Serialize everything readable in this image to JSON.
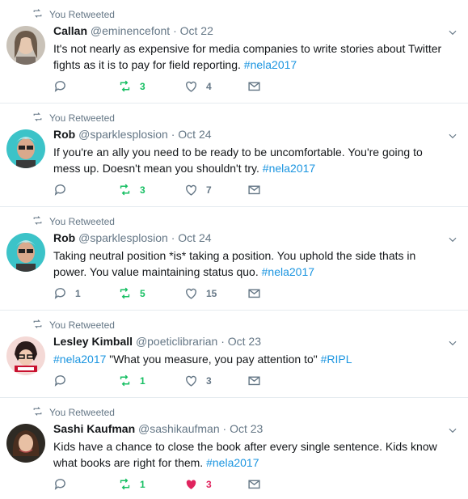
{
  "retweet_context": "You Retweeted",
  "tweets": [
    {
      "name": "Callan",
      "handle": "@eminencefont",
      "date": "Oct 22",
      "text_plain": "It's not nearly as expensive for media companies to write stories about Twitter fights as it is to pay for field reporting. ",
      "hashtags": [
        "#nela2017"
      ],
      "replies": "",
      "retweets": "3",
      "likes": "4",
      "liked": false
    },
    {
      "name": "Rob",
      "handle": "@sparklesplosion",
      "date": "Oct 24",
      "text_plain": "If you're an ally you need to be ready to be uncomfortable. You're going to mess up. Doesn't mean you shouldn't try.  ",
      "hashtags": [
        "#nela2017"
      ],
      "replies": "",
      "retweets": "3",
      "likes": "7",
      "liked": false
    },
    {
      "name": "Rob",
      "handle": "@sparklesplosion",
      "date": "Oct 24",
      "text_plain": "Taking neutral position *is* taking a position. You uphold the side thats in power. You value maintaining status quo. ",
      "hashtags": [
        "#nela2017"
      ],
      "replies": "1",
      "retweets": "5",
      "likes": "15",
      "liked": false
    },
    {
      "name": "Lesley Kimball",
      "handle": "@poeticlibrarian",
      "date": "Oct 23",
      "text_plain": " \"What you measure, you pay attention to\" ",
      "hashtags": [
        "#nela2017",
        "#RIPL"
      ],
      "replies": "",
      "retweets": "1",
      "likes": "3",
      "liked": false
    },
    {
      "name": "Sashi Kaufman",
      "handle": "@sashikaufman",
      "date": "Oct 23",
      "text_plain": "Kids have a chance to close the book after every single sentence. Kids know what books are right for them. ",
      "hashtags": [
        "#nela2017"
      ],
      "replies": "",
      "retweets": "1",
      "likes": "3",
      "liked": true
    }
  ],
  "colors": {
    "retweet_green": "#17bf63",
    "like_red": "#e0245e",
    "link_blue": "#1b95e0",
    "meta_gray": "#657786"
  },
  "icons": [
    "retweet-icon",
    "reply-icon",
    "heart-icon",
    "mail-icon",
    "chevron-down-icon"
  ]
}
